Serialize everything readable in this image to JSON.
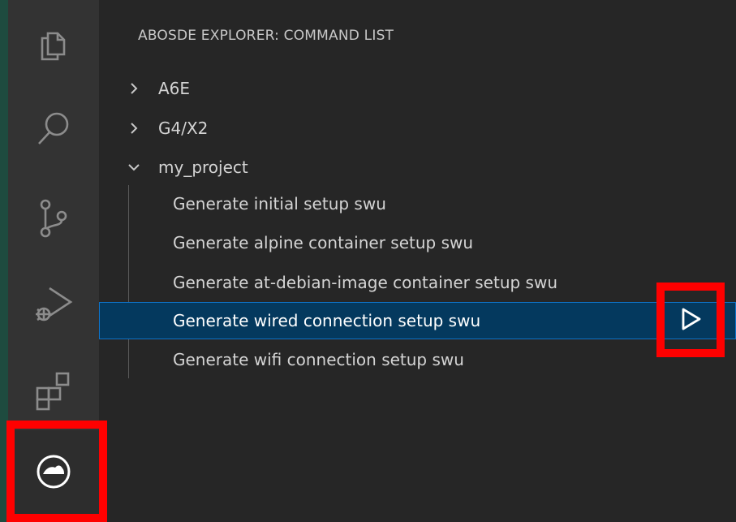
{
  "activity_bar": {
    "items": [
      {
        "icon": "files-icon"
      },
      {
        "icon": "search-icon"
      },
      {
        "icon": "source-control-icon"
      },
      {
        "icon": "run-and-debug-icon"
      },
      {
        "icon": "extensions-icon"
      },
      {
        "icon": "abos-explorer-icon",
        "active": true
      }
    ]
  },
  "panel": {
    "title": "ABOSDE EXPLORER: COMMAND LIST",
    "tree": [
      {
        "label": "A6E",
        "expanded": false
      },
      {
        "label": "G4/X2",
        "expanded": false
      },
      {
        "label": "my_project",
        "expanded": true,
        "children": [
          {
            "label": "Generate initial setup swu"
          },
          {
            "label": "Generate alpine container setup swu"
          },
          {
            "label": "Generate at-debian-image container setup swu"
          },
          {
            "label": "Generate wired connection setup swu",
            "selected": true,
            "action_icon": "play-icon"
          },
          {
            "label": "Generate wifi connection setup swu"
          }
        ]
      }
    ]
  },
  "colors": {
    "highlight_box": "#ff0000",
    "selected_row_bg": "#04395e",
    "selected_row_border": "#0e73c8",
    "activity_bar_bg": "#333333",
    "panel_bg": "#262626"
  }
}
